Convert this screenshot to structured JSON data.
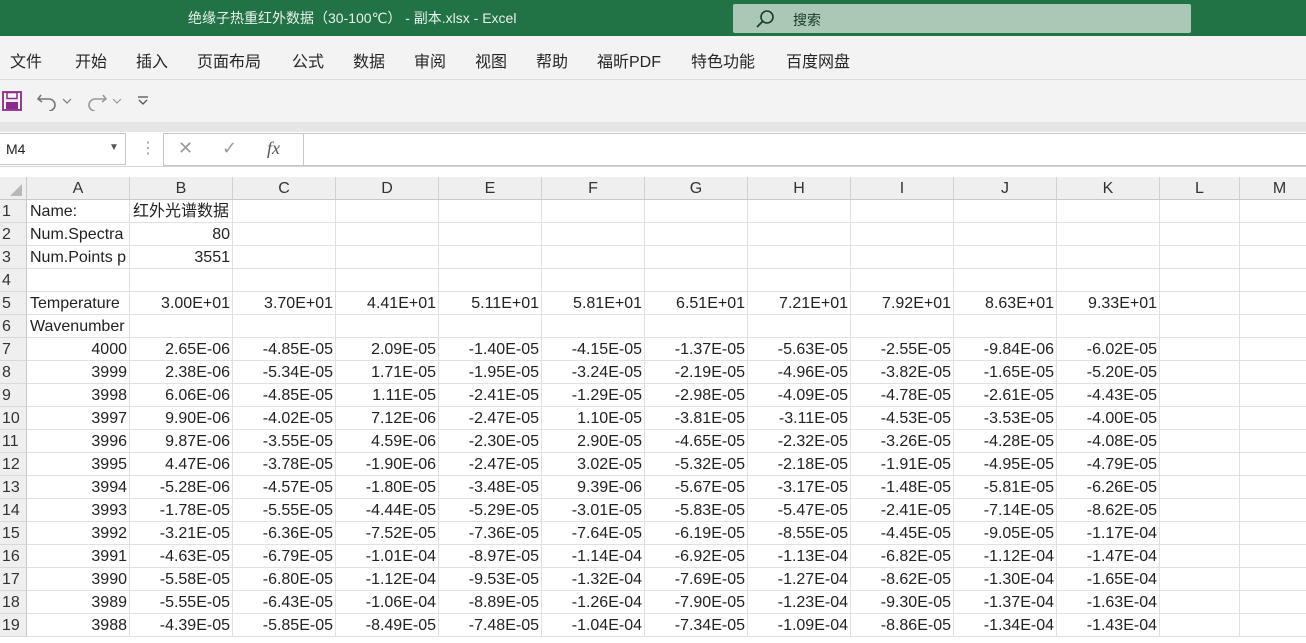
{
  "window": {
    "title": "绝缘子热重红外数据（30-100℃） - 副本.xlsx  -  Excel",
    "search_placeholder": "搜索"
  },
  "menu": [
    "文件",
    "开始",
    "插入",
    "页面布局",
    "公式",
    "数据",
    "审阅",
    "视图",
    "帮助",
    "福昕PDF",
    "特色功能",
    "百度网盘"
  ],
  "qat": {
    "save": "save-icon",
    "undo": "undo-icon",
    "redo": "redo-icon",
    "customize": "customize-icon"
  },
  "formula_bar": {
    "name_box": "M4",
    "cancel": "✕",
    "enter": "✓",
    "fx": "fx",
    "formula": ""
  },
  "sheet": {
    "columns": [
      "A",
      "B",
      "C",
      "D",
      "E",
      "F",
      "G",
      "H",
      "I",
      "J",
      "K",
      "L",
      "M"
    ],
    "rows": [
      {
        "n": "1",
        "cells": [
          "Name:",
          "红外光谱数据",
          "",
          "",
          "",
          "",
          "",
          "",
          "",
          "",
          ""
        ]
      },
      {
        "n": "2",
        "cells": [
          "Num.Spectra",
          "80",
          "",
          "",
          "",
          "",
          "",
          "",
          "",
          "",
          ""
        ]
      },
      {
        "n": "3",
        "cells": [
          "Num.Points p",
          "3551",
          "",
          "",
          "",
          "",
          "",
          "",
          "",
          "",
          ""
        ]
      },
      {
        "n": "4",
        "cells": [
          "",
          "",
          "",
          "",
          "",
          "",
          "",
          "",
          "",
          "",
          ""
        ]
      },
      {
        "n": "5",
        "cells": [
          "Temperature",
          "3.00E+01",
          "3.70E+01",
          "4.41E+01",
          "5.11E+01",
          "5.81E+01",
          "6.51E+01",
          "7.21E+01",
          "7.92E+01",
          "8.63E+01",
          "9.33E+01"
        ]
      },
      {
        "n": "6",
        "cells": [
          "Wavenumber",
          "",
          "",
          "",
          "",
          "",
          "",
          "",
          "",
          "",
          ""
        ]
      },
      {
        "n": "7",
        "cells": [
          "4000",
          "2.65E-06",
          "-4.85E-05",
          "2.09E-05",
          "-1.40E-05",
          "-4.15E-05",
          "-1.37E-05",
          "-5.63E-05",
          "-2.55E-05",
          "-9.84E-06",
          "-6.02E-05"
        ]
      },
      {
        "n": "8",
        "cells": [
          "3999",
          "2.38E-06",
          "-5.34E-05",
          "1.71E-05",
          "-1.95E-05",
          "-3.24E-05",
          "-2.19E-05",
          "-4.96E-05",
          "-3.82E-05",
          "-1.65E-05",
          "-5.20E-05"
        ]
      },
      {
        "n": "9",
        "cells": [
          "3998",
          "6.06E-06",
          "-4.85E-05",
          "1.11E-05",
          "-2.41E-05",
          "-1.29E-05",
          "-2.98E-05",
          "-4.09E-05",
          "-4.78E-05",
          "-2.61E-05",
          "-4.43E-05"
        ]
      },
      {
        "n": "10",
        "cells": [
          "3997",
          "9.90E-06",
          "-4.02E-05",
          "7.12E-06",
          "-2.47E-05",
          "1.10E-05",
          "-3.81E-05",
          "-3.11E-05",
          "-4.53E-05",
          "-3.53E-05",
          "-4.00E-05"
        ]
      },
      {
        "n": "11",
        "cells": [
          "3996",
          "9.87E-06",
          "-3.55E-05",
          "4.59E-06",
          "-2.30E-05",
          "2.90E-05",
          "-4.65E-05",
          "-2.32E-05",
          "-3.26E-05",
          "-4.28E-05",
          "-4.08E-05"
        ]
      },
      {
        "n": "12",
        "cells": [
          "3995",
          "4.47E-06",
          "-3.78E-05",
          "-1.90E-06",
          "-2.47E-05",
          "3.02E-05",
          "-5.32E-05",
          "-2.18E-05",
          "-1.91E-05",
          "-4.95E-05",
          "-4.79E-05"
        ]
      },
      {
        "n": "13",
        "cells": [
          "3994",
          "-5.28E-06",
          "-4.57E-05",
          "-1.80E-05",
          "-3.48E-05",
          "9.39E-06",
          "-5.67E-05",
          "-3.17E-05",
          "-1.48E-05",
          "-5.81E-05",
          "-6.26E-05"
        ]
      },
      {
        "n": "14",
        "cells": [
          "3993",
          "-1.78E-05",
          "-5.55E-05",
          "-4.44E-05",
          "-5.29E-05",
          "-3.01E-05",
          "-5.83E-05",
          "-5.47E-05",
          "-2.41E-05",
          "-7.14E-05",
          "-8.62E-05"
        ]
      },
      {
        "n": "15",
        "cells": [
          "3992",
          "-3.21E-05",
          "-6.36E-05",
          "-7.52E-05",
          "-7.36E-05",
          "-7.64E-05",
          "-6.19E-05",
          "-8.55E-05",
          "-4.45E-05",
          "-9.05E-05",
          "-1.17E-04"
        ]
      },
      {
        "n": "16",
        "cells": [
          "3991",
          "-4.63E-05",
          "-6.79E-05",
          "-1.01E-04",
          "-8.97E-05",
          "-1.14E-04",
          "-6.92E-05",
          "-1.13E-04",
          "-6.82E-05",
          "-1.12E-04",
          "-1.47E-04"
        ]
      },
      {
        "n": "17",
        "cells": [
          "3990",
          "-5.58E-05",
          "-6.80E-05",
          "-1.12E-04",
          "-9.53E-05",
          "-1.32E-04",
          "-7.69E-05",
          "-1.27E-04",
          "-8.62E-05",
          "-1.30E-04",
          "-1.65E-04"
        ]
      },
      {
        "n": "18",
        "cells": [
          "3989",
          "-5.55E-05",
          "-6.43E-05",
          "-1.06E-04",
          "-8.89E-05",
          "-1.26E-04",
          "-7.90E-05",
          "-1.23E-04",
          "-9.30E-05",
          "-1.37E-04",
          "-1.63E-04"
        ]
      },
      {
        "n": "19",
        "cells": [
          "3988",
          "-4.39E-05",
          "-5.85E-05",
          "-8.49E-05",
          "-7.48E-05",
          "-1.04E-04",
          "-7.34E-05",
          "-1.09E-04",
          "-8.86E-05",
          "-1.34E-04",
          "-1.43E-04"
        ]
      }
    ]
  }
}
